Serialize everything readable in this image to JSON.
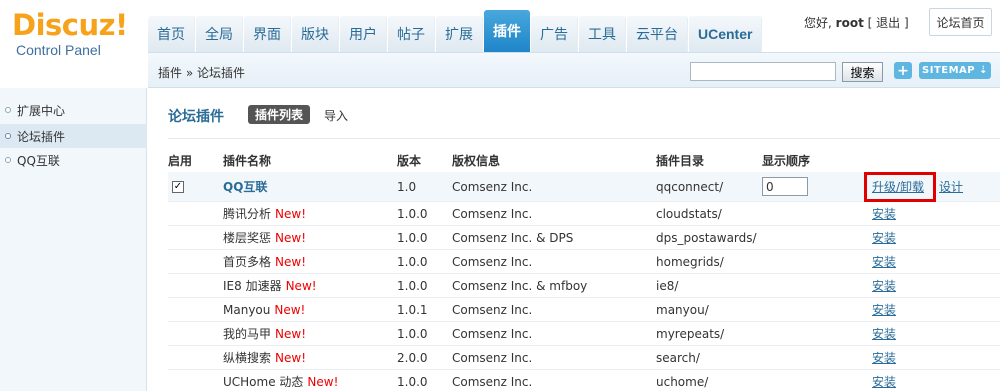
{
  "logo": {
    "main": "Discuz!",
    "sub": "Control Panel"
  },
  "nav": [
    {
      "label": "首页",
      "active": false
    },
    {
      "label": "全局",
      "active": false
    },
    {
      "label": "界面",
      "active": false
    },
    {
      "label": "版块",
      "active": false
    },
    {
      "label": "用户",
      "active": false
    },
    {
      "label": "帖子",
      "active": false
    },
    {
      "label": "扩展",
      "active": false
    },
    {
      "label": "插件",
      "active": true
    },
    {
      "label": "广告",
      "active": false
    },
    {
      "label": "工具",
      "active": false
    },
    {
      "label": "云平台",
      "active": false
    },
    {
      "label": "UCenter",
      "active": false
    }
  ],
  "user": {
    "greeting": "您好,",
    "name": "root",
    "logout": "[ 退出 ]",
    "home": "论坛首页"
  },
  "subbar": {
    "breadcrumb": "插件 » 论坛插件",
    "search_value": "",
    "search_label": "搜索",
    "plus_label": "+",
    "sitemap_label": "SITEMAP ⇣"
  },
  "sidebar": [
    {
      "label": "扩展中心",
      "active": false
    },
    {
      "label": "论坛插件",
      "active": true
    },
    {
      "label": "QQ互联",
      "active": false
    }
  ],
  "main": {
    "title": "论坛插件",
    "tab_active": "插件列表",
    "tab_import": "导入",
    "columns": [
      "启用",
      "插件名称",
      "版本",
      "版权信息",
      "插件目录",
      "显示顺序"
    ]
  },
  "plugins": [
    {
      "name": "QQ互联",
      "new": "",
      "version": "1.0",
      "copyright": "Comsenz Inc.",
      "dir": "qqconnect/",
      "order": "0",
      "action1": "升级/卸载",
      "action2": "设计",
      "enabled": true
    },
    {
      "name": "腾讯分析",
      "new": "New!",
      "version": "1.0.0",
      "copyright": "Comsenz Inc.",
      "dir": "cloudstats/",
      "action1": "安装"
    },
    {
      "name": "楼层奖惩",
      "new": "New!",
      "version": "1.0.0",
      "copyright": "Comsenz Inc. & DPS",
      "dir": "dps_postawards/",
      "action1": "安装"
    },
    {
      "name": "首页多格",
      "new": "New!",
      "version": "1.0.0",
      "copyright": "Comsenz Inc.",
      "dir": "homegrids/",
      "action1": "安装"
    },
    {
      "name": "IE8 加速器",
      "new": "New!",
      "version": "1.0.0",
      "copyright": "Comsenz Inc. & mfboy",
      "dir": "ie8/",
      "action1": "安装"
    },
    {
      "name": "Manyou",
      "new": "New!",
      "version": "1.0.1",
      "copyright": "Comsenz Inc.",
      "dir": "manyou/",
      "action1": "安装"
    },
    {
      "name": "我的马甲",
      "new": "New!",
      "version": "1.0.0",
      "copyright": "Comsenz Inc.",
      "dir": "myrepeats/",
      "action1": "安装"
    },
    {
      "name": "纵横搜索",
      "new": "New!",
      "version": "2.0.0",
      "copyright": "Comsenz Inc.",
      "dir": "search/",
      "action1": "安装"
    },
    {
      "name": "UCHome 动态",
      "new": "New!",
      "version": "1.0.0",
      "copyright": "Comsenz Inc.",
      "dir": "uchome/",
      "action1": "安装"
    }
  ]
}
